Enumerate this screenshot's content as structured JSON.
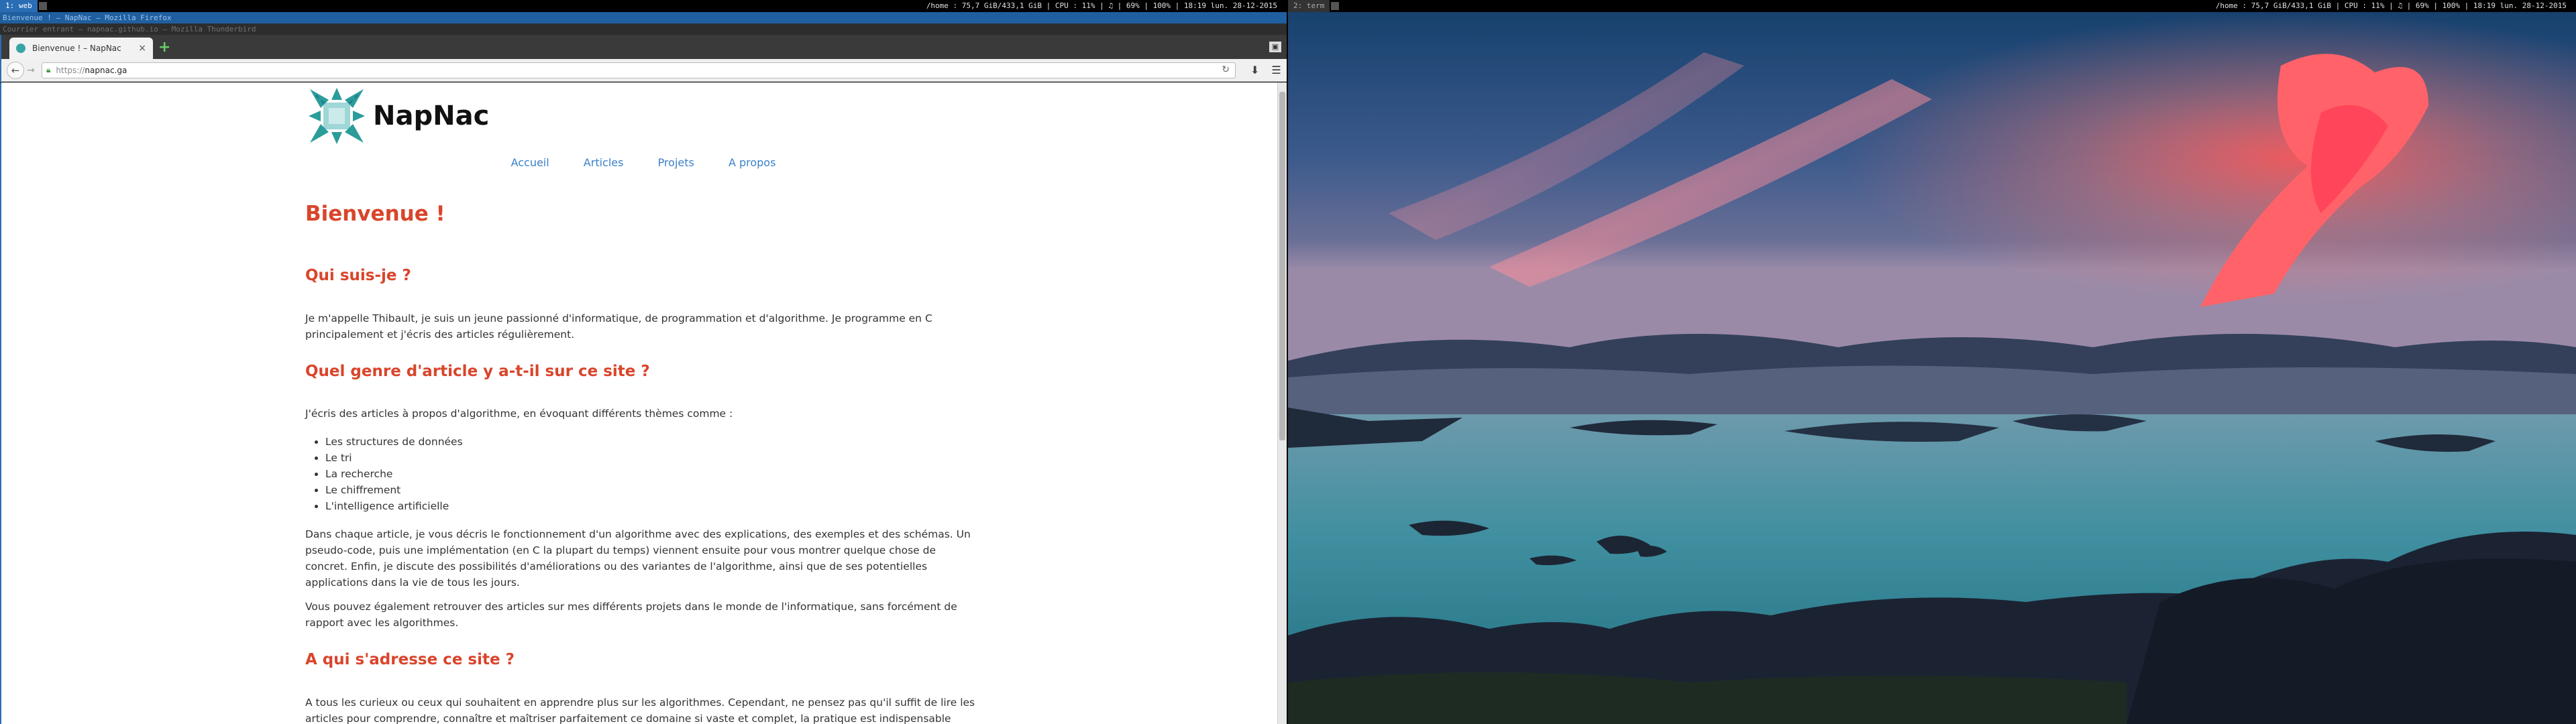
{
  "statusbar_left": {
    "workspaces": [
      {
        "label": "1: web",
        "active": true
      }
    ],
    "status": "/home : 75,7 GiB/433,1 GiB | CPU : 11% | ♫ | 69% | 100% | 18:19 lun. 28-12-2015"
  },
  "statusbar_right": {
    "workspaces": [
      {
        "label": "2: term",
        "active": false
      }
    ],
    "status": "/home : 75,7 GiB/433,1 GiB | CPU : 11% | ♫ | 69% | 100% | 18:19 lun. 28-12-2015"
  },
  "window_titles": [
    "Bienvenue ! – NapNac – Mozilla Firefox",
    "Courrier entrant – napnac.github.io – Mozilla Thunderbird"
  ],
  "browser": {
    "tab_title": "Bienvenue ! – NapNac",
    "tab_close": "×",
    "new_tab": "+",
    "url_scheme": "https://",
    "url_host": "napnac.ga",
    "back_glyph": "←",
    "forward_glyph": "→",
    "reload_glyph": "↻",
    "download_glyph": "⬇",
    "menu_glyph": "☰",
    "window_btn": "▣"
  },
  "site": {
    "name": "NapNac",
    "nav": [
      "Accueil",
      "Articles",
      "Projets",
      "A propos"
    ],
    "h1": "Bienvenue !",
    "sections": [
      {
        "heading": "Qui suis-je ?",
        "paragraphs": [
          "Je m'appelle Thibault, je suis un jeune passionné d'informatique, de programmation et d'algorithme. Je programme en C principalement et j'écris des articles régulièrement."
        ]
      },
      {
        "heading": "Quel genre d'article y a-t-il sur ce site ?",
        "intro": "J'écris des articles à propos d'algorithme, en évoquant différents thèmes comme :",
        "list": [
          "Les structures de données",
          "Le tri",
          "La recherche",
          "Le chiffrement",
          "L'intelligence artificielle"
        ],
        "paragraphs": [
          "Dans chaque article, je vous décris le fonctionnement d'un algorithme avec des explications, des exemples et des schémas. Un pseudo-code, puis une implémentation (en C la plupart du temps) viennent ensuite pour vous montrer quelque chose de concret. Enfin, je discute des possibilités d'améliorations ou des variantes de l'algorithme, ainsi que de ses potentielles applications dans la vie de tous les jours.",
          "Vous pouvez également retrouver des articles sur mes différents projets dans le monde de l'informatique, sans forcément de rapport avec les algorithmes."
        ]
      },
      {
        "heading": "A qui s'adresse ce site ?",
        "paragraphs": [
          "A tous les curieux ou ceux qui souhaitent en apprendre plus sur les algorithmes. Cependant, ne pensez pas qu'il suffit de lire les articles pour comprendre, connaître et maîtriser parfaitement ce domaine si vaste et complet, la pratique est indispensable (surtout"
        ]
      }
    ]
  },
  "colors": {
    "accent": "#2a6db5",
    "heading": "#d9452b",
    "link": "#3b80c9"
  }
}
